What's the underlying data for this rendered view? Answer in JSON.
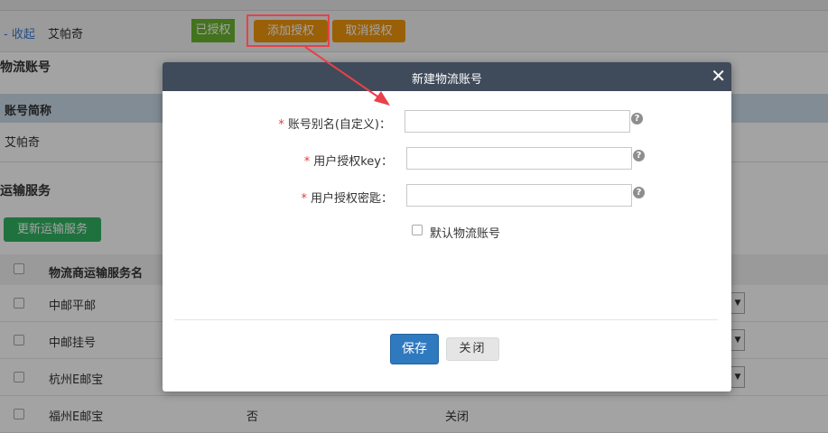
{
  "toolbar": {
    "collapse_label": "- 收起",
    "shop_name": "艾帕奇",
    "authorized_badge": "已授权",
    "add_auth_label": "添加授权",
    "cancel_auth_label": "取消授权"
  },
  "logistics_account": {
    "section_title": "物流账号",
    "column_header": "账号简称",
    "rows": [
      "艾帕奇"
    ]
  },
  "transport": {
    "section_title": "运输服务",
    "update_button": "更新运输服务",
    "column_header": "物流商运输服务名",
    "rows": [
      {
        "name": "中邮平邮",
        "col2": "",
        "col3": ""
      },
      {
        "name": "中邮挂号",
        "col2": "",
        "col3": ""
      },
      {
        "name": "杭州E邮宝",
        "col2": "",
        "col3": ""
      },
      {
        "name": "福州E邮宝",
        "col2": "否",
        "col3": "关闭"
      }
    ],
    "dropdown_glyph": "▼"
  },
  "modal": {
    "title": "新建物流账号",
    "close_glyph": "✕",
    "required_mark": "*",
    "fields": [
      {
        "label": "账号别名(自定义)：",
        "value": "",
        "placeholder": ""
      },
      {
        "label": "用户授权key：",
        "value": "",
        "placeholder": ""
      },
      {
        "label": "用户授权密匙：",
        "value": "",
        "placeholder": ""
      }
    ],
    "help_glyph": "?",
    "default_checkbox_label": "默认物流账号",
    "save_label": "保存",
    "close_label": "关闭"
  },
  "colors": {
    "modal_header": "#3f4a5a",
    "orange_button": "#f0960e",
    "green_badge": "#6ab42e",
    "green_button": "#31b262",
    "save_button": "#2f79bf",
    "annotation_red": "#e8414a"
  },
  "icons": {
    "close": "close-icon",
    "help": "help-icon",
    "arrow": "annotation-arrow"
  }
}
